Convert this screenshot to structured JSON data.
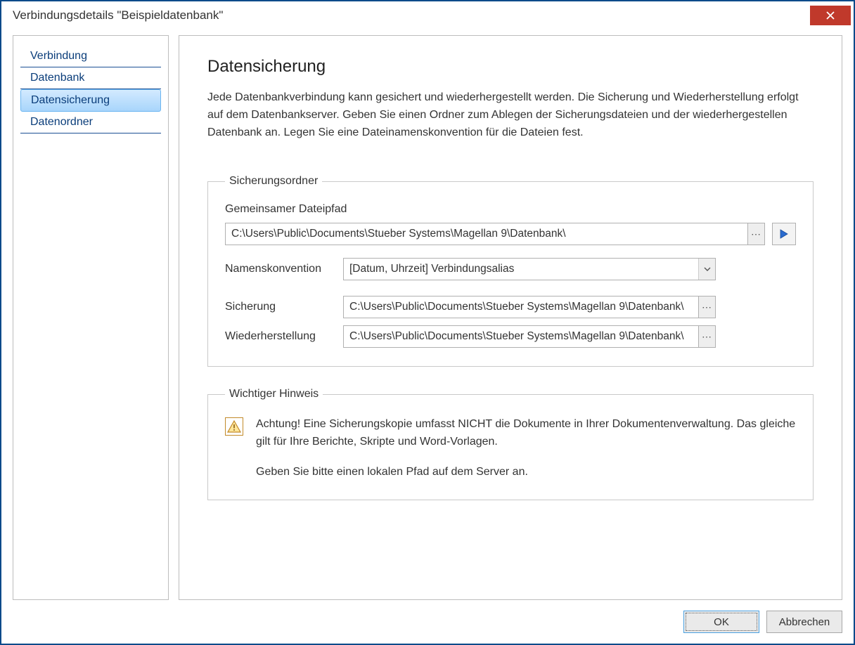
{
  "window": {
    "title": "Verbindungsdetails \"Beispieldatenbank\""
  },
  "sidebar": {
    "items": [
      {
        "label": "Verbindung"
      },
      {
        "label": "Datenbank"
      },
      {
        "label": "Datensicherung"
      },
      {
        "label": "Datenordner"
      }
    ],
    "selected_index": 2
  },
  "page": {
    "title": "Datensicherung",
    "description": "Jede Datenbankverbindung kann gesichert und wiederhergestellt werden. Die Sicherung und Wiederherstellung erfolgt auf dem Datenbankserver. Geben Sie einen Ordner zum Ablegen der Sicherungsdateien und der wiederhergestellen Datenbank an. Legen Sie eine Dateinamenskonvention für die Dateien fest."
  },
  "group_backup": {
    "legend": "Sicherungsordner",
    "shared_path_label": "Gemeinsamer Dateipfad",
    "shared_path_value": "C:\\Users\\Public\\Documents\\Stueber Systems\\Magellan 9\\Datenbank\\",
    "naming_label": "Namenskonvention",
    "naming_value": "[Datum, Uhrzeit] Verbindungsalias",
    "backup_label": "Sicherung",
    "backup_value": "C:\\Users\\Public\\Documents\\Stueber Systems\\Magellan 9\\Datenbank\\",
    "restore_label": "Wiederherstellung",
    "restore_value": "C:\\Users\\Public\\Documents\\Stueber Systems\\Magellan 9\\Datenbank\\",
    "ellipsis": "⋯"
  },
  "group_hint": {
    "legend": "Wichtiger Hinweis",
    "line1": "Achtung! Eine Sicherungskopie umfasst NICHT die Dokumente in Ihrer Dokumentenverwaltung. Das gleiche gilt für Ihre Berichte, Skripte und Word-Vorlagen.",
    "line2": "Geben Sie bitte einen lokalen Pfad auf dem Server an."
  },
  "footer": {
    "ok": "OK",
    "cancel": "Abbrechen"
  }
}
